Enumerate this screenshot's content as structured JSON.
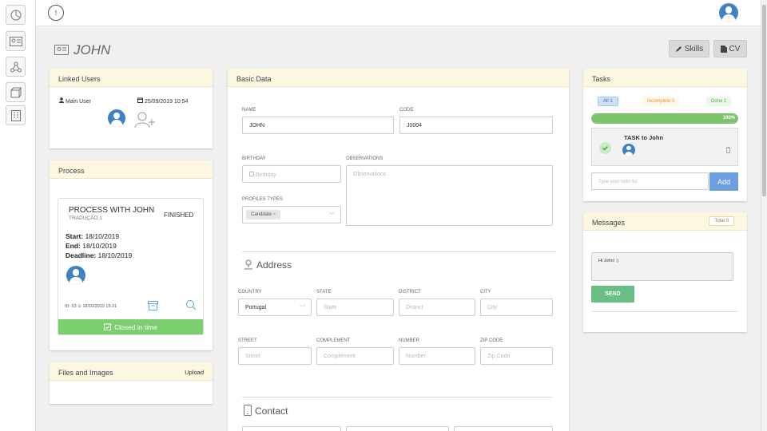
{
  "page": {
    "title": "JOHN",
    "skills_label": "Skills",
    "cv_label": "CV",
    "info_label": "!"
  },
  "linked_users": {
    "heading": "Linked Users",
    "role": "Main User",
    "date": "25/09/2019 10:54"
  },
  "process": {
    "heading": "Process",
    "name": "PROCESS WITH JOHN",
    "subtitle": "TRADUÇÃO 1",
    "status": "FINISHED",
    "start_label": "Start:",
    "start": "18/10/2019",
    "end_label": "End:",
    "end": "18/10/2019",
    "deadline_label": "Deadline:",
    "deadline": "18/10/2019",
    "meta": "ID: 63 ⊙ 18/10/2019 15:21",
    "closed": "Closed in time"
  },
  "files": {
    "heading": "Files and Images",
    "upload": "Upload"
  },
  "basic": {
    "heading": "Basic Data",
    "name_label": "NAME",
    "name_value": "JOHN",
    "code_label": "CODE",
    "code_value": "J0004",
    "birthday_label": "BIRTHDAY",
    "birthday_placeholder": "Birthday",
    "observations_label": "OBSERVATIONS",
    "observations_placeholder": "Observations",
    "profiles_label": "PROFILES TYPES",
    "profile_tag": "Canddate"
  },
  "address": {
    "title": "Address",
    "country_label": "COUNTRY",
    "country_value": "Portugal",
    "state_label": "STATE",
    "state_placeholder": "State",
    "district_label": "DISTRICT",
    "district_placeholder": "District",
    "city_label": "CITY",
    "city_placeholder": "City",
    "street_label": "STREET",
    "street_placeholder": "Street",
    "complement_label": "COMPLEMENT",
    "complement_placeholder": "Complement",
    "number_label": "NUMBER",
    "number_placeholder": "Number",
    "zip_label": "ZIP CODE",
    "zip_placeholder": "Zip Code"
  },
  "contact": {
    "title": "Contact"
  },
  "tasks": {
    "heading": "Tasks",
    "filter_all": "All 1",
    "filter_incomplete": "Incomplete 0",
    "filter_done": "Done 1",
    "progress_label": "100%",
    "progress": 1.0,
    "task_title": "TASK to John",
    "input_placeholder": "Type your todo list",
    "add_label": "Add"
  },
  "messages": {
    "heading": "Messages",
    "total": "Total 0",
    "text": "Hi John! :)",
    "send": "SEND"
  },
  "colors": {
    "accent": "#3f82c4",
    "success": "#7ccf6e",
    "send": "#6cbf84",
    "add": "#6d9ee0",
    "header": "#fbf7e1"
  }
}
